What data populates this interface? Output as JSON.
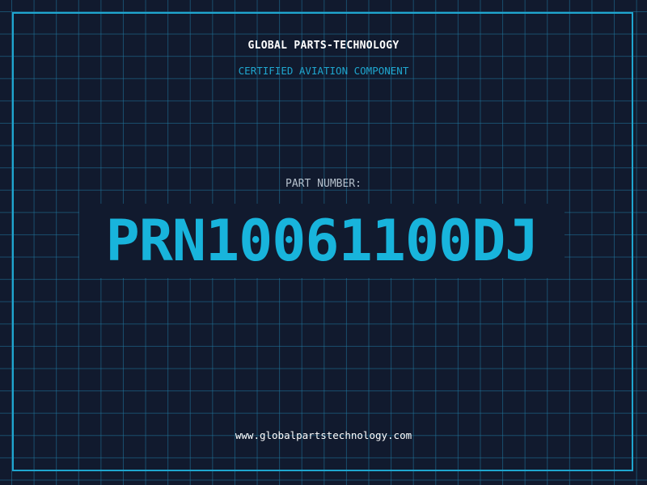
{
  "header": {
    "brand": "GLOBAL PARTS-TECHNOLOGY",
    "subtitle": "CERTIFIED AVIATION COMPONENT"
  },
  "part": {
    "label": "PART NUMBER:",
    "number": "PRN10061100DJ"
  },
  "footer": {
    "website": "www.globalpartstechnology.com"
  },
  "colors": {
    "background": "#111a2e",
    "grid": "#1f6f92",
    "accent": "#18b4dc",
    "text": "#ffffff",
    "muted": "#b5c0cc"
  }
}
